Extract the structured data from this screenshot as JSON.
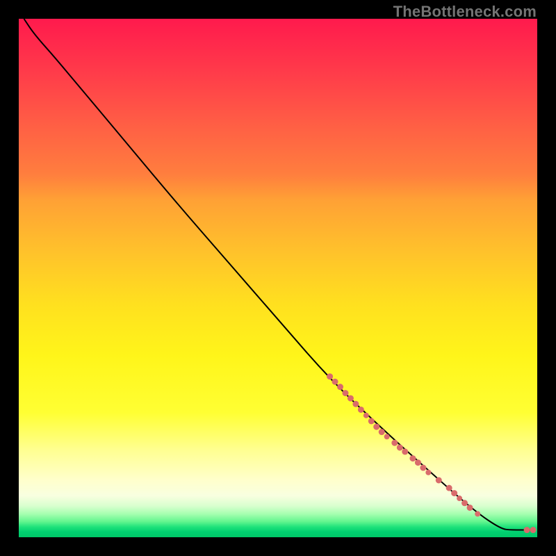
{
  "watermark": "TheBottleneck.com",
  "chart_data": {
    "type": "line",
    "title": "",
    "xlabel": "",
    "ylabel": "",
    "xlim": [
      0,
      100
    ],
    "ylim": [
      0,
      100
    ],
    "grid": false,
    "legend": false,
    "curve": [
      {
        "x": 1,
        "y": 100
      },
      {
        "x": 3,
        "y": 97
      },
      {
        "x": 7,
        "y": 92.5
      },
      {
        "x": 12,
        "y": 86.5
      },
      {
        "x": 20,
        "y": 77
      },
      {
        "x": 30,
        "y": 65
      },
      {
        "x": 40,
        "y": 53.5
      },
      {
        "x": 50,
        "y": 42
      },
      {
        "x": 60,
        "y": 30.5
      },
      {
        "x": 70,
        "y": 21
      },
      {
        "x": 80,
        "y": 12
      },
      {
        "x": 88,
        "y": 5
      },
      {
        "x": 93,
        "y": 1.6
      },
      {
        "x": 95,
        "y": 1.4
      },
      {
        "x": 99,
        "y": 1.4
      }
    ],
    "markers": [
      {
        "x": 60,
        "y": 31,
        "r": 4.5
      },
      {
        "x": 61,
        "y": 30,
        "r": 4.5
      },
      {
        "x": 62,
        "y": 29,
        "r": 4.5
      },
      {
        "x": 63,
        "y": 27.8,
        "r": 4.5
      },
      {
        "x": 64,
        "y": 26.8,
        "r": 4.5
      },
      {
        "x": 65,
        "y": 25.7,
        "r": 4.5
      },
      {
        "x": 66,
        "y": 24.6,
        "r": 4.5
      },
      {
        "x": 67,
        "y": 23.5,
        "r": 4
      },
      {
        "x": 68,
        "y": 22.4,
        "r": 4.5
      },
      {
        "x": 69,
        "y": 21.3,
        "r": 4.5
      },
      {
        "x": 70,
        "y": 20.3,
        "r": 4.5
      },
      {
        "x": 71,
        "y": 19.4,
        "r": 4
      },
      {
        "x": 72.5,
        "y": 18.2,
        "r": 4.5
      },
      {
        "x": 73.5,
        "y": 17.3,
        "r": 4.5
      },
      {
        "x": 74.5,
        "y": 16.5,
        "r": 4.5
      },
      {
        "x": 76,
        "y": 15.2,
        "r": 4.5
      },
      {
        "x": 77,
        "y": 14.4,
        "r": 4.5
      },
      {
        "x": 78,
        "y": 13.4,
        "r": 4.5
      },
      {
        "x": 79,
        "y": 12.5,
        "r": 4
      },
      {
        "x": 81,
        "y": 11,
        "r": 4.5
      },
      {
        "x": 83,
        "y": 9.5,
        "r": 4.5
      },
      {
        "x": 84,
        "y": 8.5,
        "r": 4.5
      },
      {
        "x": 85,
        "y": 7.5,
        "r": 4
      },
      {
        "x": 86,
        "y": 6.6,
        "r": 4.5
      },
      {
        "x": 87,
        "y": 5.7,
        "r": 4.5
      },
      {
        "x": 88.5,
        "y": 4.5,
        "r": 4
      },
      {
        "x": 98,
        "y": 1.4,
        "r": 4.5
      },
      {
        "x": 99.2,
        "y": 1.4,
        "r": 4.5
      }
    ],
    "colors": {
      "curve": "#000000",
      "marker": "#d96b6b"
    }
  }
}
